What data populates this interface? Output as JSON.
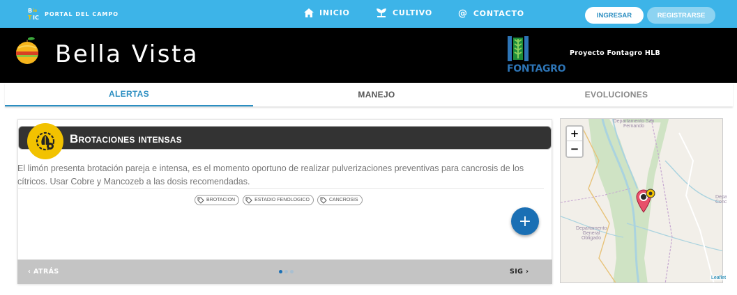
{
  "nav": {
    "brand_text": "PORTAL DEL CAMPO",
    "links": [
      {
        "label": "INICIO",
        "icon": "home-icon"
      },
      {
        "label": "CULTIVO",
        "icon": "sprout-icon"
      },
      {
        "label": "CONTACTO",
        "icon": "at-icon"
      }
    ],
    "login_label": "INGRESAR",
    "register_label": "REGISTRARSE"
  },
  "header": {
    "title": "Bella Vista",
    "partner_logo_text": "FONTAGRO",
    "project": "Proyecto Fontagro HLB"
  },
  "tabs": [
    {
      "label": "ALERTAS",
      "active": true
    },
    {
      "label": "MANEJO",
      "active": false
    },
    {
      "label": "EVOLUCIONES",
      "active": false
    }
  ],
  "alert": {
    "title": "Brotaciones intensas",
    "icon": "plant-stage-icon",
    "body": "El limón presenta brotación pareja e intensa, es el momento oportuno de realizar pulverizaciones preventivas para cancrosis de los cítricos. Usar Cobre y Mancozeb a las dosis recomendadas.",
    "tags": [
      "BROTACION",
      "ESTADIO FENOLOGICO",
      "CANCROSIS"
    ],
    "fab_label": "+"
  },
  "pager": {
    "prev_label": "ATRÁS",
    "next_label": "SIG",
    "pages": 3,
    "current_page": 1
  },
  "map": {
    "zoom_in": "+",
    "zoom_out": "−",
    "labels": {
      "dept_top": "Departamento San Fernando",
      "dept_left": "Departamento General Obligado",
      "dept_right": "Depart Conc"
    },
    "attribution": "Leaflet"
  },
  "colors": {
    "nav_bg": "#3db4e8",
    "accent": "#2b8ec1",
    "fab": "#1a6fb4",
    "alert_icon_bg": "#f2c200",
    "card_head_bg": "#333333"
  }
}
